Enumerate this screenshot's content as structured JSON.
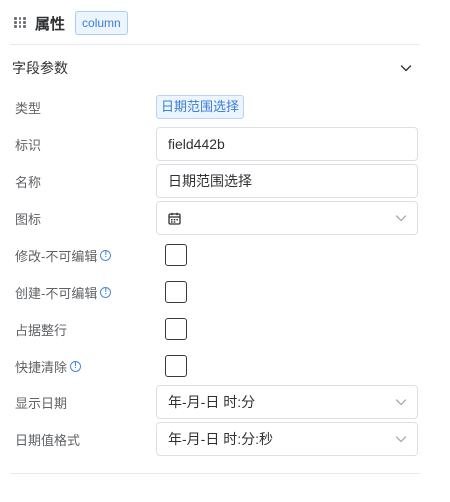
{
  "header": {
    "title": "属性",
    "tag": "column"
  },
  "section": {
    "title": "字段参数"
  },
  "fields": {
    "type": {
      "label": "类型",
      "value": "日期范围选择"
    },
    "id": {
      "label": "标识",
      "value": "field442b"
    },
    "name": {
      "label": "名称",
      "value": "日期范围选择"
    },
    "icon": {
      "label": "图标",
      "value": "calendar-icon"
    },
    "edit_readonly": {
      "label": "修改-不可编辑",
      "checked": false
    },
    "create_readonly": {
      "label": "创建-不可编辑",
      "checked": false
    },
    "full_row": {
      "label": "占据整行",
      "checked": false
    },
    "quick_clear": {
      "label": "快捷清除",
      "checked": false
    },
    "display_date": {
      "label": "显示日期",
      "value": "年-月-日 时:分"
    },
    "date_value_format": {
      "label": "日期值格式",
      "value": "年-月-日 时:分:秒"
    }
  },
  "colors": {
    "accent": "#3a7fd5",
    "border": "#dcdfe6",
    "label": "#5f6266"
  }
}
